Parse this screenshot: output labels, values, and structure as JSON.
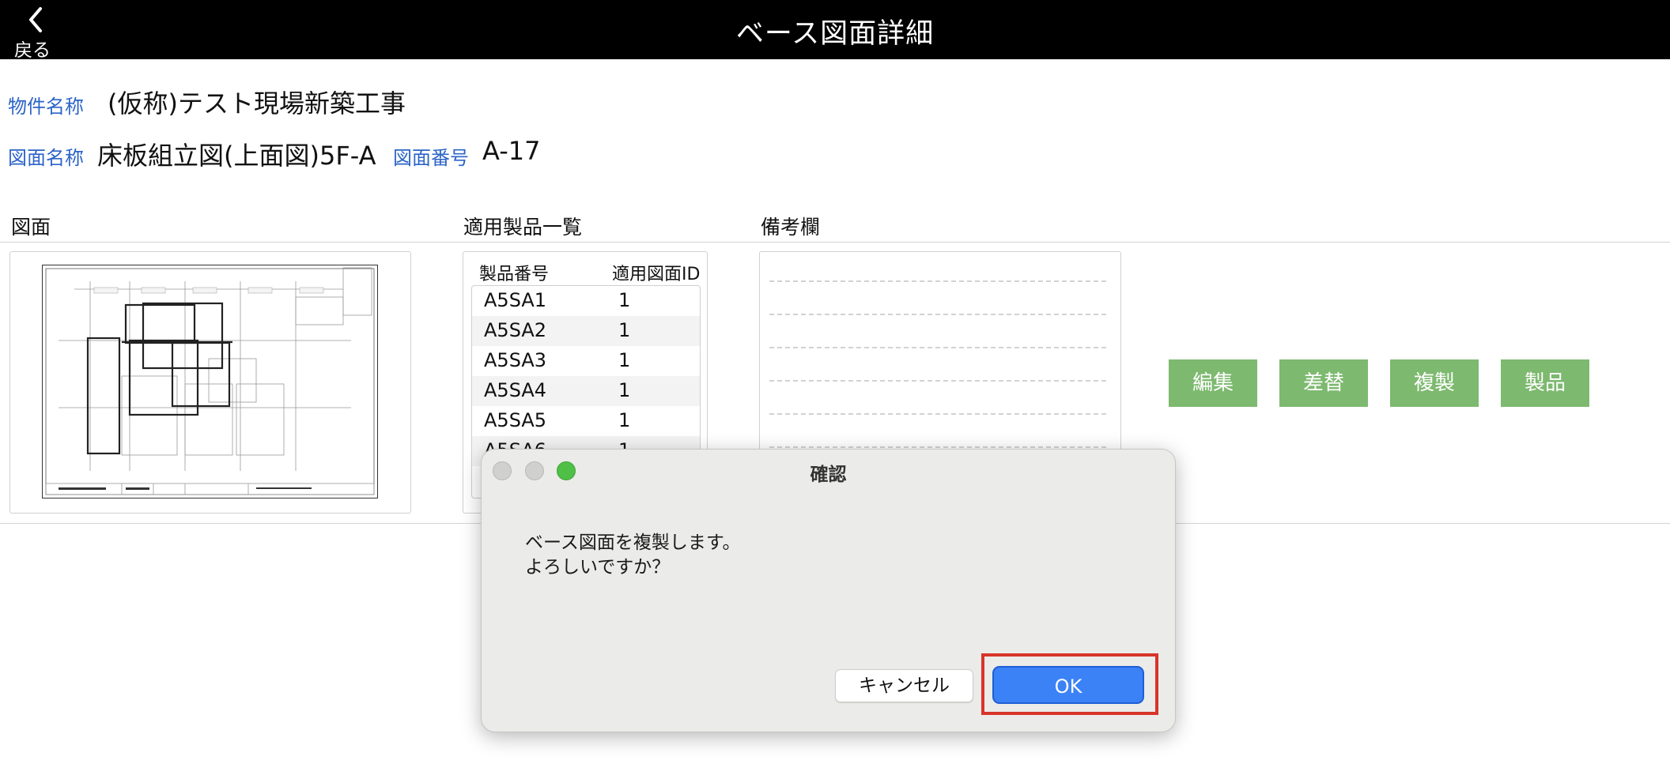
{
  "header": {
    "back_label": "戻る",
    "title": "ベース図面詳細"
  },
  "info": {
    "property_label": "物件名称",
    "property_value": "(仮称)テスト現場新築工事",
    "drawing_name_label": "図面名称",
    "drawing_name_value": "床板組立図(上面図)5F-A",
    "drawing_number_label": "図面番号",
    "drawing_number_value": "A-17"
  },
  "sections": {
    "drawing": "図面",
    "products": "適用製品一覧",
    "notes": "備考欄"
  },
  "products_table": {
    "headers": [
      "製品番号",
      "適用図面ID"
    ],
    "rows": [
      {
        "product": "A5SA1",
        "id": "1"
      },
      {
        "product": "A5SA2",
        "id": "1"
      },
      {
        "product": "A5SA3",
        "id": "1"
      },
      {
        "product": "A5SA4",
        "id": "1"
      },
      {
        "product": "A5SA5",
        "id": "1"
      },
      {
        "product": "A5SA6",
        "id": "1"
      }
    ]
  },
  "actions": {
    "edit": "編集",
    "replace": "差替",
    "duplicate": "複製",
    "product": "製品"
  },
  "dialog": {
    "title": "確認",
    "message_line1": "ベース図面を複製します。",
    "message_line2": "よろしいですか？",
    "cancel": "キャンセル",
    "ok": "OK"
  },
  "colors": {
    "header_bg": "#000000",
    "label_blue": "#2c64c8",
    "action_green": "#7db96f",
    "ok_blue": "#3b82f6",
    "highlight_red": "#d8342a"
  }
}
